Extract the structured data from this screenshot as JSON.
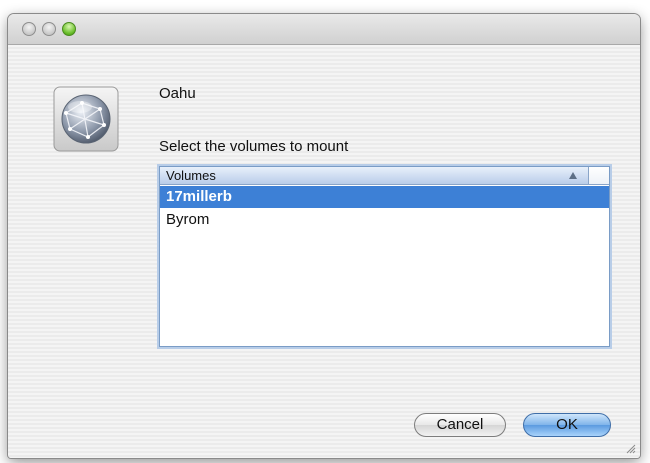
{
  "window": {
    "controls": [
      "close",
      "minimize",
      "zoom"
    ]
  },
  "dialog": {
    "server_name": "Oahu",
    "prompt": "Select the volumes to mount",
    "icon": "network-globe-icon"
  },
  "volumes": {
    "header": "Volumes",
    "sort": "ascending",
    "items": [
      {
        "label": "17millerb",
        "selected": true
      },
      {
        "label": "Byrom",
        "selected": false
      }
    ]
  },
  "buttons": {
    "cancel_label": "Cancel",
    "ok_label": "OK"
  },
  "colors": {
    "selection": "#3d80d6",
    "default_button": "#6aa6e6"
  }
}
